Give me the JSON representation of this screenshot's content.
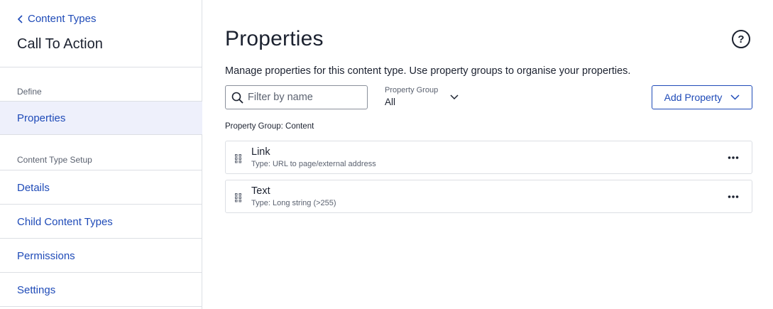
{
  "sidebar": {
    "back_label": "Content Types",
    "title": "Call To Action",
    "define_label": "Define",
    "properties_label": "Properties",
    "setup_label": "Content Type Setup",
    "items": [
      {
        "label": "Details"
      },
      {
        "label": "Child Content Types"
      },
      {
        "label": "Permissions"
      },
      {
        "label": "Settings"
      }
    ]
  },
  "main": {
    "title": "Properties",
    "help_label": "?",
    "description": "Manage properties for this content type. Use property groups to organise your properties.",
    "search": {
      "placeholder": "Filter by name",
      "value": ""
    },
    "group_filter": {
      "label": "Property Group",
      "value": "All"
    },
    "add_button": "Add Property",
    "group_heading": "Property Group: Content",
    "properties": [
      {
        "name": "Link",
        "type": "Type: URL to page/external address"
      },
      {
        "name": "Text",
        "type": "Type: Long string (>255)"
      }
    ]
  },
  "icons": {
    "back": "chevron-left-icon",
    "help": "help-circle-icon",
    "search": "search-icon",
    "dropdown": "chevron-down-icon",
    "drag": "drag-handle-icon",
    "more": "more-horizontal-icon"
  },
  "colors": {
    "accent": "#1f4bb8",
    "active_nav_bg": "#eef0fb",
    "border": "#dcdfe4",
    "text": "#1c2230",
    "muted": "#5b6270"
  }
}
